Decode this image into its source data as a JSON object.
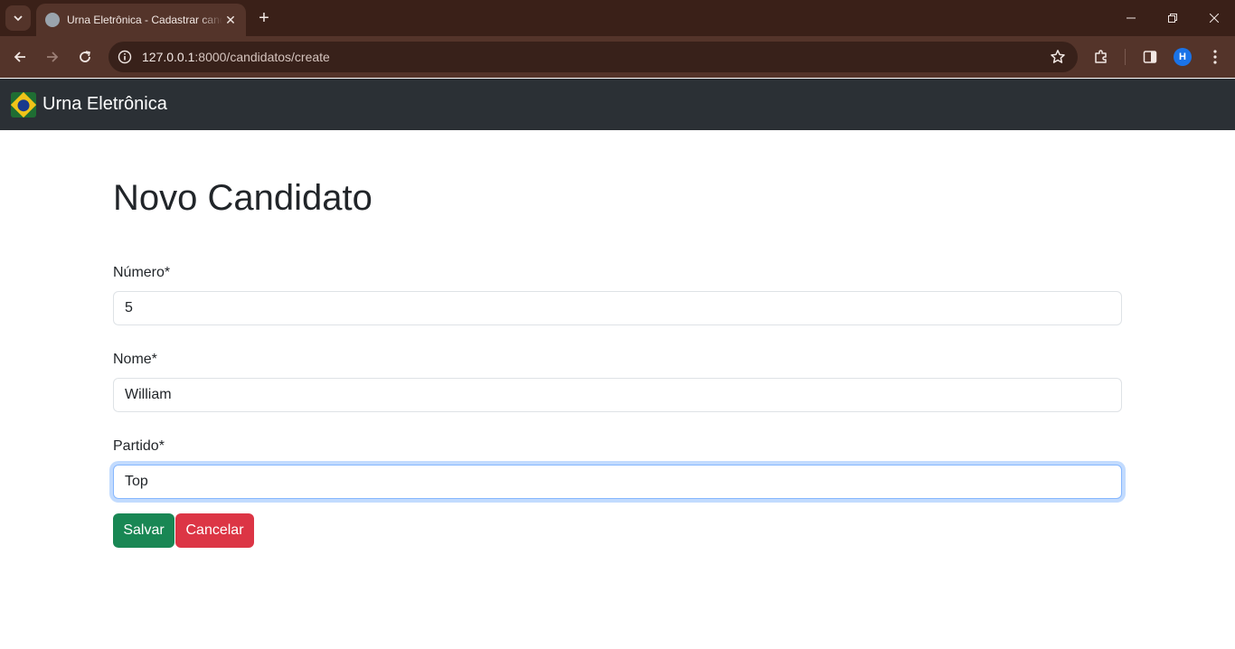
{
  "browser": {
    "tab_title": "Urna Eletrônica - Cadastrar candidato",
    "url_host": "127.0.0.1",
    "url_path": ":8000/candidatos/create",
    "profile_initial": "H"
  },
  "navbar": {
    "brand": "Urna Eletrônica"
  },
  "page": {
    "title": "Novo Candidato"
  },
  "form": {
    "numero": {
      "label": "Número*",
      "value": "5"
    },
    "nome": {
      "label": "Nome*",
      "value": "William"
    },
    "partido": {
      "label": "Partido*",
      "value": "Top"
    },
    "save_label": "Salvar",
    "cancel_label": "Cancelar"
  },
  "colors": {
    "navbar": "#2b3035",
    "save": "#198754",
    "cancel": "#dc3545"
  }
}
